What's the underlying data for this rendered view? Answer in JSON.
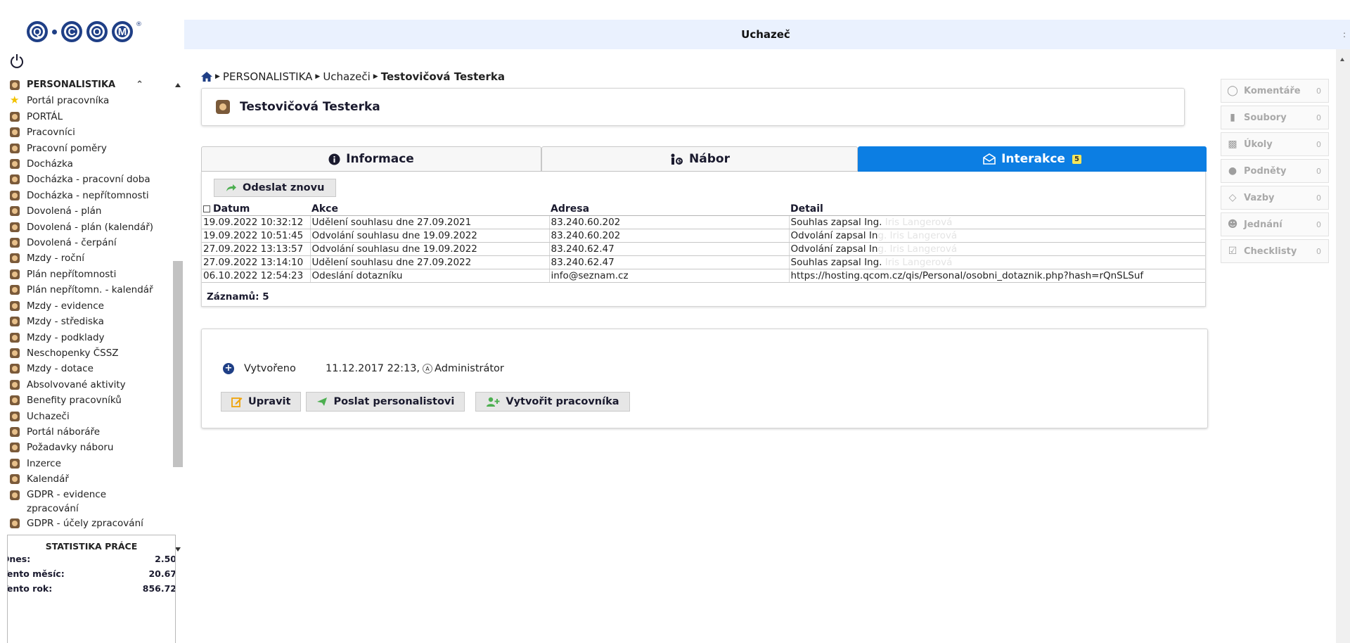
{
  "logo": {
    "letters": [
      "Q",
      "C",
      "O",
      "M"
    ],
    "mark": "®"
  },
  "header": {
    "title": "Uchazeč",
    "menu_dots": ":"
  },
  "sidebar": {
    "section": "PERSONALISTIKA",
    "items": [
      {
        "label": "Portál pracovníka",
        "icon": "star-icon"
      },
      {
        "label": "PORTÁL"
      },
      {
        "label": "Pracovníci"
      },
      {
        "label": "Pracovní poměry"
      },
      {
        "label": "Docházka"
      },
      {
        "label": "Docházka - pracovní doba"
      },
      {
        "label": "Docházka - nepřítomnosti"
      },
      {
        "label": "Dovolená - plán"
      },
      {
        "label": "Dovolená - plán (kalendář)"
      },
      {
        "label": "Dovolená - čerpání"
      },
      {
        "label": "Mzdy - roční"
      },
      {
        "label": "Plán nepřítomnosti"
      },
      {
        "label": "Plán nepřítomn. - kalendář"
      },
      {
        "label": "Mzdy - evidence"
      },
      {
        "label": "Mzdy - střediska"
      },
      {
        "label": "Mzdy - podklady"
      },
      {
        "label": "Neschopenky ČSSZ"
      },
      {
        "label": "Mzdy - dotace"
      },
      {
        "label": "Absolvované aktivity"
      },
      {
        "label": "Benefity pracovníků"
      },
      {
        "label": "Uchazeči"
      },
      {
        "label": "Portál náboráře"
      },
      {
        "label": "Požadavky náboru"
      },
      {
        "label": "Inzerce"
      },
      {
        "label": "Kalendář"
      },
      {
        "label": "GDPR - evidence zpracování"
      },
      {
        "label": "GDPR - účely zpracování"
      }
    ]
  },
  "stats": {
    "title": "STATISTIKA PRÁCE",
    "rows": [
      {
        "label": "Dnes:",
        "value": "2.50"
      },
      {
        "label": "Tento měsíc:",
        "value": "20.67"
      },
      {
        "label": "Tento rok:",
        "value": "856.72"
      }
    ]
  },
  "breadcrumb": {
    "items": [
      "PERSONALISTIKA",
      "Uchazeči"
    ],
    "current": "Testovičová Testerka"
  },
  "candidate": {
    "name": "Testovičová Testerka"
  },
  "tabs": [
    {
      "label": "Informace",
      "icon": "info-icon"
    },
    {
      "label": "Nábor",
      "icon": "recruit-icon"
    },
    {
      "label": "Interakce",
      "icon": "envelope-icon",
      "badge": "5",
      "active": true
    }
  ],
  "interakce": {
    "resend_label": "Odeslat znovu",
    "columns": [
      "Datum",
      "Akce",
      "Adresa",
      "Detail"
    ],
    "rows": [
      {
        "datum": "19.09.2022 10:32:12",
        "akce": "Udělení souhlasu dne 27.09.2021",
        "adresa": "83.240.60.202",
        "detail": "Souhlas zapsal Ing.",
        "detail_faint": " Iris Langerová"
      },
      {
        "datum": "19.09.2022 10:51:45",
        "akce": "Odvolání souhlasu dne 19.09.2022",
        "adresa": "83.240.60.202",
        "detail": "Odvolání zapsal In",
        "detail_faint": "g. Iris Langerová"
      },
      {
        "datum": "27.09.2022 13:13:57",
        "akce": "Odvolání souhlasu dne 19.09.2022",
        "adresa": "83.240.62.47",
        "detail": "Odvolání zapsal In",
        "detail_faint": "g. Iris Langerová"
      },
      {
        "datum": "27.09.2022 13:14:10",
        "akce": "Udělení souhlasu dne 27.09.2022",
        "adresa": "83.240.62.47",
        "detail": "Souhlas zapsal Ing.",
        "detail_faint": " Iris Langerová"
      },
      {
        "datum": "06.10.2022 12:54:23",
        "akce": "Odeslání dotazníku",
        "adresa": "info@seznam.cz",
        "detail": "https://hosting.qcom.cz/qis/Personal/osobni_dotaznik.php?hash=rQnSLSuf",
        "detail_faint": ""
      }
    ],
    "records_label": "Záznamů: 5"
  },
  "info": {
    "created_label": "Vytvořeno",
    "created_value": "11.12.2017 22:13,",
    "admin_badge": "A",
    "created_by": "Administrátor",
    "buttons": [
      "Upravit",
      "Poslat personalistovi",
      "Vytvořit pracovníka"
    ]
  },
  "widgets": [
    {
      "label": "Komentáře",
      "count": "0",
      "icon": "comment-icon"
    },
    {
      "label": "Soubory",
      "count": "0",
      "icon": "file-icon"
    },
    {
      "label": "Úkoly",
      "count": "0",
      "icon": "clipboard-icon"
    },
    {
      "label": "Podněty",
      "count": "0",
      "icon": "lightbulb-icon"
    },
    {
      "label": "Vazby",
      "count": "0",
      "icon": "link-icon"
    },
    {
      "label": "Jednání",
      "count": "0",
      "icon": "people-icon"
    },
    {
      "label": "Checklisty",
      "count": "0",
      "icon": "checkbox-icon"
    }
  ],
  "colors": {
    "header_bg": "#eaf1fe",
    "active_tab": "#0c7ee3",
    "brand": "#1f3f86",
    "badge": "#f5e65a"
  }
}
